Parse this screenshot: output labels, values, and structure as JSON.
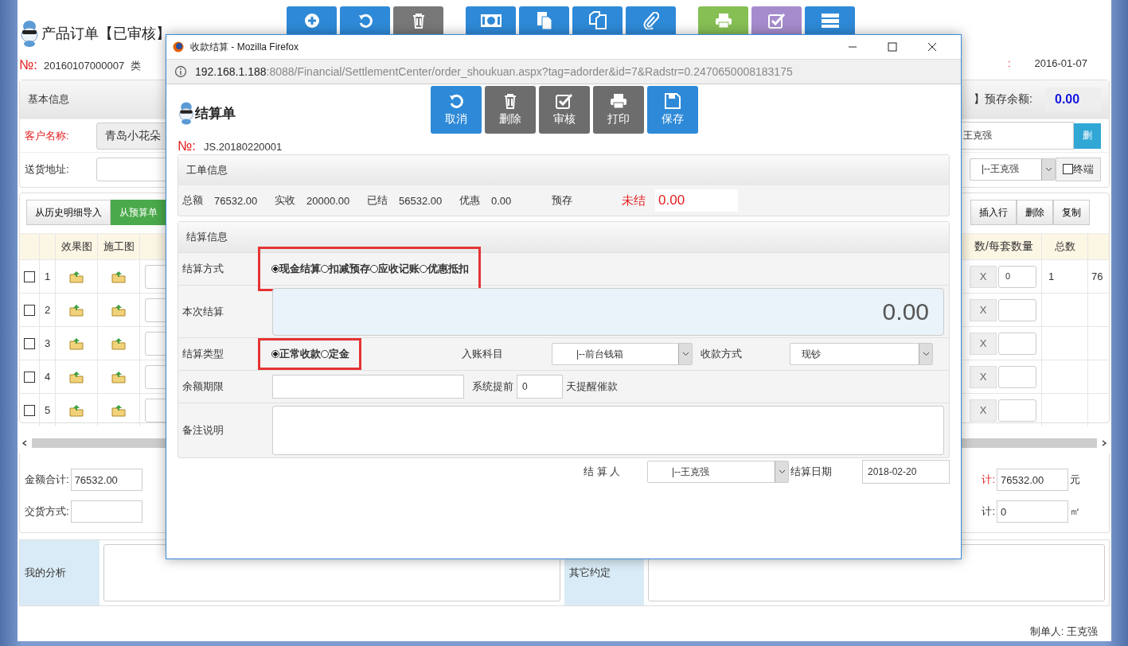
{
  "toolbar": [
    {
      "kind": "add",
      "color": "#2e8ad8"
    },
    {
      "kind": "undo",
      "color": "#2e8ad8"
    },
    {
      "kind": "trash",
      "color": "#787878"
    },
    {
      "kind": "money",
      "color": "#2e8ad8"
    },
    {
      "kind": "document",
      "color": "#2e8ad8"
    },
    {
      "kind": "copy",
      "color": "#2e8ad8"
    },
    {
      "kind": "attach",
      "color": "#2e8ad8"
    },
    {
      "kind": "print",
      "color": "#86bf54"
    },
    {
      "kind": "approve",
      "color": "#a58ccd"
    },
    {
      "kind": "list",
      "color": "#2e8ad8"
    }
  ],
  "order": {
    "title": "产品订单【已审核】",
    "no_label": "№:",
    "no": "20160107000007",
    "type_label": "类",
    "date_label": ":",
    "date": "2016-01-07"
  },
  "basic": {
    "title": "基本信息",
    "deposit_label": "】预存余额:",
    "deposit": "0.00",
    "customer_label": "客户名称:",
    "customer": "青岛小花朵",
    "contact": "王克强",
    "delete_button": "删",
    "address_label": "送货地址:",
    "salesman": "|--王克强",
    "terminal_label": "终端",
    "terminal_checked": false
  },
  "detail": {
    "left_buttons": [
      {
        "label": "从历史明细导入",
        "kind": "plain"
      },
      {
        "label": "从预算单",
        "kind": "success"
      }
    ],
    "right_buttons": [
      "插入行",
      "删除",
      "复制"
    ],
    "columns_left": [
      "效果图",
      "施工图"
    ],
    "columns_right": [
      "数/每套数量",
      "总数"
    ],
    "rows": [
      {
        "no": "1",
        "checked": false,
        "clear": "X",
        "set_count": "0",
        "total": "1",
        "amount": "76"
      },
      {
        "no": "2",
        "checked": false,
        "clear": "X"
      },
      {
        "no": "3",
        "checked": false,
        "clear": "X"
      },
      {
        "no": "4",
        "checked": false,
        "clear": "X"
      },
      {
        "no": "5",
        "checked": false,
        "clear": "X"
      }
    ]
  },
  "footer": {
    "amount_label": "金额合计:",
    "amount": "76532.00",
    "right_label": "计:",
    "right_amount": "76532.00",
    "right_unit": "元",
    "delivery_label": "交货方式:",
    "area_label": "计:",
    "area": "0",
    "area_unit": "㎡"
  },
  "notes": {
    "analysis_label": "我的分析",
    "other_label": "其它约定"
  },
  "maker": {
    "label": "制单人:",
    "name": "王克强"
  },
  "popup": {
    "window_title": "收款结算 - Mozilla Firefox",
    "url_host": "192.168.1.188",
    "url_rest": ":8088/Financial/SettlementCenter/order_shoukuan.aspx?tag=adorder&id=7&Radstr=0.2470650008183175",
    "title": "结算单",
    "buttons": [
      {
        "label": "取消",
        "kind": "undo",
        "color": "#2e8ad8"
      },
      {
        "label": "删除",
        "kind": "trash",
        "color": "#6d6d6d"
      },
      {
        "label": "审核",
        "kind": "approve",
        "color": "#6d6d6d"
      },
      {
        "label": "打印",
        "kind": "print",
        "color": "#6d6d6d"
      },
      {
        "label": "保存",
        "kind": "save",
        "color": "#2e8ad8"
      }
    ],
    "no_label": "№:",
    "no": "JS.20180220001",
    "work_title": "工单信息",
    "summary": [
      {
        "label": "总额",
        "value": "76532.00"
      },
      {
        "label": "实收",
        "value": "20000.00"
      },
      {
        "label": "已结",
        "value": "56532.00"
      },
      {
        "label": "优惠",
        "value": "0.00"
      },
      {
        "label": "预存"
      }
    ],
    "unsettled_label": "未结",
    "unsettled": "0.00",
    "settle_title": "结算信息",
    "method_label": "结算方式",
    "method_highlighted": true,
    "methods": [
      {
        "label": "现金结算",
        "selected": true
      },
      {
        "label": "扣减预存",
        "selected": false
      },
      {
        "label": "应收记账",
        "selected": false
      },
      {
        "label": "优惠抵扣",
        "selected": false
      }
    ],
    "amount_label": "本次结算",
    "amount": "0.00",
    "type_label": "结算类型",
    "type_highlighted": true,
    "types": [
      {
        "label": "正常收款",
        "selected": true
      },
      {
        "label": "定金",
        "selected": false
      }
    ],
    "account_label": "入账科目",
    "account": "|--前台钱箱",
    "pay_label": "收款方式",
    "pay": "现钞",
    "term_label": "余额期限",
    "remind_label": "系统提前",
    "remind_days": "0",
    "remind_suffix": "天提醒催款",
    "remark_label": "备注说明",
    "person_label": "结 算 人",
    "person": "|--王克强",
    "date_label": "结算日期",
    "date": "2018-02-20"
  }
}
